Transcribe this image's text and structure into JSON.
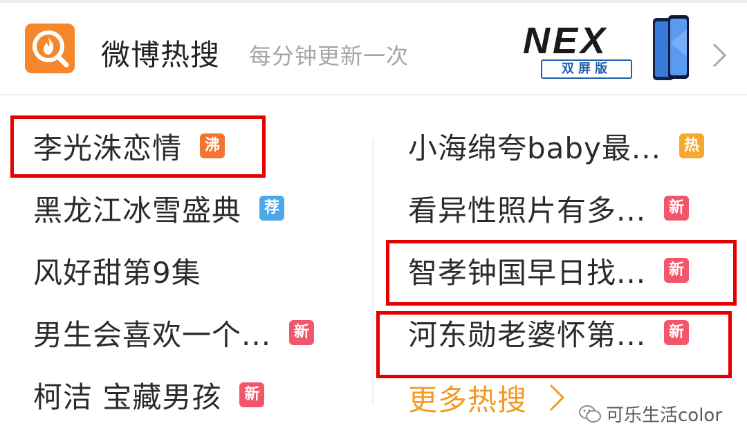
{
  "header": {
    "title": "微博热搜",
    "subtitle": "每分钟更新一次",
    "logo_icon": "weibo-hot-search-logo-icon",
    "ad": {
      "brand": "NEX",
      "badge": "双屏版",
      "image_icon": "smartphone-icon"
    },
    "more_icon": "chevron-right-icon"
  },
  "hot_list": {
    "left": [
      {
        "text": "李光洙恋情",
        "badge": "沸",
        "badge_color": "#f37332"
      },
      {
        "text": "黑龙江冰雪盛典",
        "badge": "荐",
        "badge_color": "#4ea7e8"
      },
      {
        "text": "风好甜第9集",
        "badge": "",
        "badge_color": ""
      },
      {
        "text": "男生会喜欢一个...",
        "badge": "新",
        "badge_color": "#f1566a"
      },
      {
        "text": "柯洁 宝藏男孩",
        "badge": "新",
        "badge_color": "#f1566a"
      }
    ],
    "right": [
      {
        "text": "小海绵夸baby最...",
        "badge": "热",
        "badge_color": "#f8a92d"
      },
      {
        "text": "看异性照片有多...",
        "badge": "新",
        "badge_color": "#f1566a"
      },
      {
        "text": "智孝钟国早日找...",
        "badge": "新",
        "badge_color": "#f1566a"
      },
      {
        "text": "河东勋老婆怀第...",
        "badge": "新",
        "badge_color": "#f1566a"
      }
    ],
    "more_label": "更多热搜",
    "more_icon": "chevron-right-icon"
  },
  "watermark": {
    "text": "可乐生活color",
    "icon": "wechat-icon"
  },
  "colors": {
    "highlight": "#e50000",
    "accent_orange": "#f39a23",
    "logo_orange": "#f5862a"
  }
}
